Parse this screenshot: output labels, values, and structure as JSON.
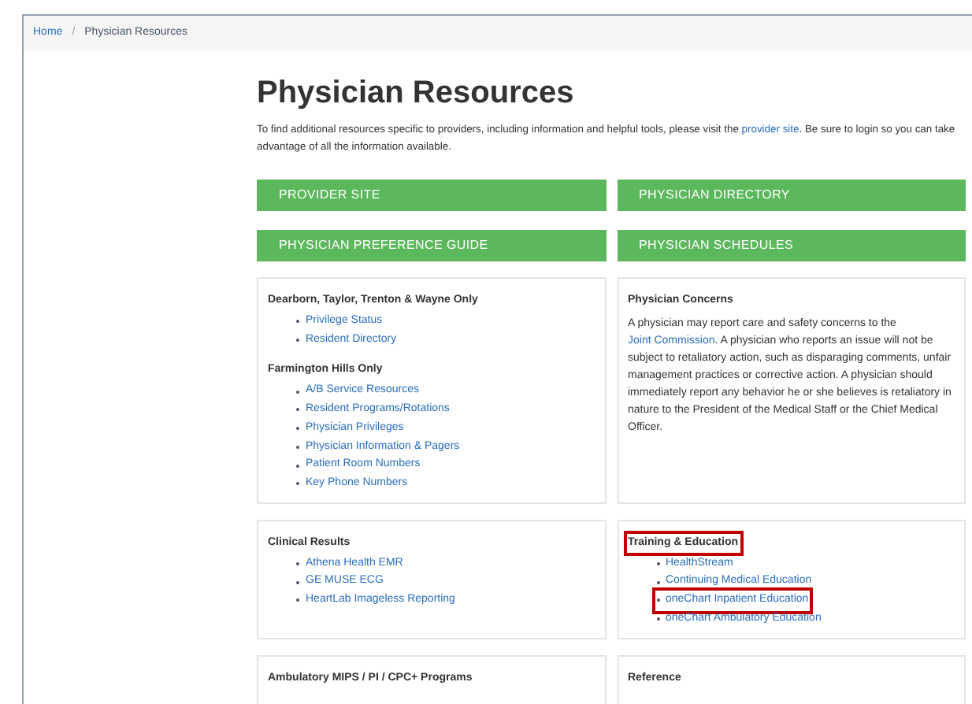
{
  "breadcrumb": {
    "separator": "/",
    "items": [
      "Home",
      "Physician Resources"
    ]
  },
  "title": "Physician Resources",
  "intro": {
    "before": "To find additional resources specific to providers, including information and helpful tools, please visit the ",
    "link": "provider site",
    "after": ". Be sure to login so you can take advantage of all the information available."
  },
  "buttons": [
    "PROVIDER SITE",
    "PHYSICIAN DIRECTORY",
    "PHYSICIAN PREFERENCE GUIDE",
    "PHYSICIAN SCHEDULES"
  ],
  "cards": [
    {
      "sections": [
        {
          "heading": "Dearborn, Taylor, Trenton & Wayne Only",
          "links": [
            {
              "label": "Privilege Status"
            },
            {
              "label": "Resident Directory"
            }
          ]
        },
        {
          "heading": "Farmington Hills Only",
          "links": [
            {
              "label": "A/B Service Resources"
            },
            {
              "label": "Resident Programs/Rotations"
            },
            {
              "label": "Physician Privileges"
            },
            {
              "label": "Physician Information & Pagers"
            },
            {
              "label": "Patient Room Numbers"
            },
            {
              "label": "Key Phone Numbers"
            }
          ]
        }
      ]
    },
    {
      "sections": [
        {
          "heading": "Physician Concerns",
          "paragraph": {
            "link": "Joint Commission",
            "after": ". A physician who reports an issue will not be subject to retaliatory action, such as disparaging comments, unfair management practices or corrective action. A physician should immediately report any behavior he or she believes is retaliatory in nature to the President of the Medical Staff or the Chief Medical Officer.",
            "before": "A physician may report care and safety concerns to the "
          }
        }
      ]
    },
    {
      "sections": [
        {
          "heading": "Clinical Results",
          "links": [
            {
              "label": "Athena Health EMR"
            },
            {
              "label": "GE MUSE ECG"
            },
            {
              "label": "HeartLab Imageless Reporting"
            }
          ]
        }
      ]
    },
    {
      "sections": [
        {
          "heading": "Training & Education",
          "highlighted": true,
          "links": [
            {
              "label": "HealthStream",
              "highlighted": false
            },
            {
              "label": "Continuing Medical Education",
              "highlighted": false
            },
            {
              "label": "oneChart Inpatient Education",
              "highlighted": true
            },
            {
              "label": "oneChart Ambulatory Education",
              "highlighted": false
            }
          ]
        }
      ]
    },
    {
      "sections": [
        {
          "heading": "Ambulatory MIPS / PI / CPC+ Programs"
        }
      ]
    },
    {
      "sections": [
        {
          "heading": "Reference"
        }
      ]
    }
  ]
}
